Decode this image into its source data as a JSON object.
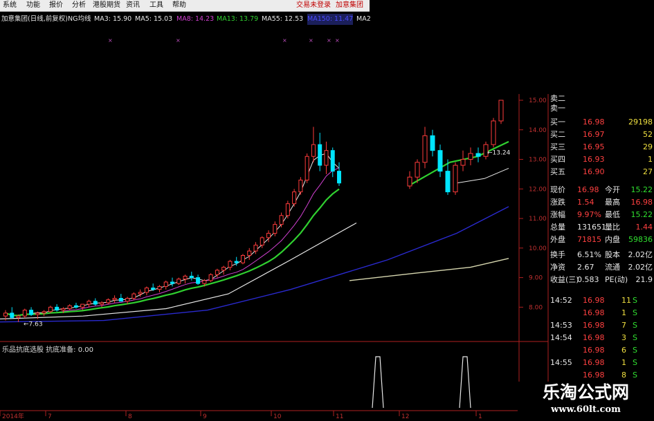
{
  "menu": {
    "items": [
      "系统",
      "功能",
      "报价",
      "分析",
      "港股期货",
      "资讯",
      "工具",
      "帮助"
    ],
    "login": "交易未登录",
    "stock_name": "加意集团"
  },
  "ma_bar": {
    "title": "加意集团(日线,前复权)",
    "indicator": "NG均线",
    "ma": [
      {
        "label": "MA3: 15.90",
        "color": "#e8e8e8"
      },
      {
        "label": "MA5: 15.03",
        "color": "#e8e8e8"
      },
      {
        "label": "MA8: 14.23",
        "color": "#d040d0"
      },
      {
        "label": "MA13: 13.79",
        "color": "#30d030"
      },
      {
        "label": "MA55: 12.53",
        "color": "#e8e8e8"
      },
      {
        "label": "MA150: 11.47",
        "color": "#3030ff"
      },
      {
        "label": "MA2",
        "color": "#e8e8e8"
      }
    ]
  },
  "price_axis": {
    "ticks": [
      "15.00",
      "14.00",
      "13.00",
      "12.00",
      "11.00",
      "10.00",
      "9.00",
      "8.00"
    ]
  },
  "chart_data": {
    "type": "candlestick",
    "x_ticks": [
      "2014年",
      "7",
      "8",
      "9",
      "10",
      "11",
      "12",
      "1"
    ],
    "y_range": [
      7.4,
      15.0
    ],
    "annotations": {
      "low": "7.63",
      "mid": "13.24"
    },
    "colors": {
      "up": "#ff3b3b",
      "down": "#00e5ff",
      "ma_fast": "#e8e8e8",
      "ma8": "#d040d0",
      "ma13": "#30d030",
      "ma55": "#e8e8e8",
      "ma150": "#2a2ad0",
      "ma_long": "#d8d8b0"
    },
    "candles": [
      [
        7.7,
        7.9,
        7.55,
        7.8
      ],
      [
        7.8,
        8.0,
        7.6,
        7.65
      ],
      [
        7.65,
        7.75,
        7.5,
        7.7
      ],
      [
        7.7,
        7.95,
        7.63,
        7.9
      ],
      [
        7.9,
        8.0,
        7.7,
        7.75
      ],
      [
        7.75,
        7.85,
        7.6,
        7.8
      ],
      [
        7.8,
        7.9,
        7.7,
        7.85
      ],
      [
        7.85,
        8.05,
        7.8,
        8.0
      ],
      [
        8.0,
        8.1,
        7.85,
        7.9
      ],
      [
        7.9,
        8.0,
        7.8,
        7.95
      ],
      [
        7.95,
        8.1,
        7.9,
        8.05
      ],
      [
        8.05,
        8.15,
        7.95,
        8.0
      ],
      [
        8.0,
        8.1,
        7.9,
        8.1
      ],
      [
        8.1,
        8.25,
        8.0,
        8.2
      ],
      [
        8.2,
        8.3,
        8.05,
        8.1
      ],
      [
        8.1,
        8.2,
        8.0,
        8.15
      ],
      [
        8.15,
        8.3,
        8.1,
        8.25
      ],
      [
        8.25,
        8.4,
        8.15,
        8.3
      ],
      [
        8.3,
        8.45,
        8.2,
        8.2
      ],
      [
        8.2,
        8.35,
        8.1,
        8.3
      ],
      [
        8.3,
        8.5,
        8.25,
        8.45
      ],
      [
        8.45,
        8.6,
        8.35,
        8.5
      ],
      [
        8.5,
        8.7,
        8.4,
        8.65
      ],
      [
        8.65,
        8.8,
        8.55,
        8.6
      ],
      [
        8.6,
        8.75,
        8.5,
        8.7
      ],
      [
        8.7,
        8.9,
        8.6,
        8.85
      ],
      [
        8.85,
        9.0,
        8.7,
        8.8
      ],
      [
        8.8,
        9.0,
        8.75,
        8.95
      ],
      [
        8.95,
        9.1,
        8.8,
        9.05
      ],
      [
        9.05,
        9.2,
        8.9,
        9.0
      ],
      [
        9.0,
        9.1,
        8.75,
        8.8
      ],
      [
        8.8,
        8.95,
        8.7,
        8.9
      ],
      [
        8.9,
        9.15,
        8.85,
        9.1
      ],
      [
        9.1,
        9.3,
        9.0,
        9.25
      ],
      [
        9.25,
        9.4,
        9.1,
        9.35
      ],
      [
        9.35,
        9.6,
        9.25,
        9.55
      ],
      [
        9.55,
        9.7,
        9.4,
        9.5
      ],
      [
        9.5,
        9.8,
        9.45,
        9.75
      ],
      [
        9.75,
        10.0,
        9.6,
        9.9
      ],
      [
        9.9,
        10.2,
        9.8,
        10.1
      ],
      [
        10.1,
        10.4,
        10.0,
        10.35
      ],
      [
        10.35,
        10.6,
        10.2,
        10.5
      ],
      [
        10.5,
        10.9,
        10.4,
        10.8
      ],
      [
        10.8,
        11.2,
        10.7,
        11.1
      ],
      [
        11.1,
        11.6,
        11.0,
        11.5
      ],
      [
        11.5,
        12.0,
        11.4,
        11.9
      ],
      [
        11.9,
        12.4,
        11.8,
        12.3
      ],
      [
        12.3,
        13.2,
        12.2,
        13.1
      ],
      [
        13.1,
        14.1,
        12.9,
        13.5
      ],
      [
        13.5,
        13.9,
        12.6,
        12.8
      ],
      [
        12.8,
        13.6,
        12.5,
        13.3
      ],
      [
        13.3,
        13.4,
        12.4,
        12.6
      ],
      [
        12.6,
        12.9,
        12.1,
        12.2
      ]
    ]
  },
  "quote": {
    "sell_header": [
      "卖二",
      "卖一"
    ],
    "bids": [
      {
        "label": "买一",
        "price": "16.98",
        "vol": "29198"
      },
      {
        "label": "买二",
        "price": "16.97",
        "vol": "52"
      },
      {
        "label": "买三",
        "price": "16.95",
        "vol": "29"
      },
      {
        "label": "买四",
        "price": "16.93",
        "vol": "1"
      },
      {
        "label": "买五",
        "price": "16.90",
        "vol": "27"
      }
    ],
    "stats": [
      {
        "l1": "现价",
        "v1": "16.98",
        "l2": "今开",
        "v2": "15.22",
        "c1": "#ff4040",
        "c2": "#30e030"
      },
      {
        "l1": "涨跌",
        "v1": "1.54",
        "l2": "最高",
        "v2": "16.98",
        "c1": "#ff4040",
        "c2": "#ff4040"
      },
      {
        "l1": "涨幅",
        "v1": "9.97%",
        "l2": "最低",
        "v2": "15.22",
        "c1": "#ff4040",
        "c2": "#30e030"
      },
      {
        "l1": "总量",
        "v1": "131651",
        "l2": "量比",
        "v2": "1.44",
        "c1": "#e8e8e8",
        "c2": "#ff4040"
      },
      {
        "l1": "外盘",
        "v1": "71815",
        "l2": "内盘",
        "v2": "59836",
        "c1": "#ff4040",
        "c2": "#30e030"
      },
      {
        "l1": "换手",
        "v1": "6.51%",
        "l2": "股本",
        "v2": "2.02亿",
        "c1": "#e8e8e8",
        "c2": "#e8e8e8"
      },
      {
        "l1": "净资",
        "v1": "2.67",
        "l2": "流通",
        "v2": "2.02亿",
        "c1": "#e8e8e8",
        "c2": "#e8e8e8"
      },
      {
        "l1": "收益(三)",
        "v1": "0.583",
        "l2": "PE(动)",
        "v2": "21.9",
        "c1": "#e8e8e8",
        "c2": "#e8e8e8"
      }
    ],
    "ticks": [
      {
        "time": "14:52",
        "price": "16.98",
        "vol": "11",
        "side": "S"
      },
      {
        "time": "",
        "price": "16.98",
        "vol": "1",
        "side": "S"
      },
      {
        "time": "14:53",
        "price": "16.98",
        "vol": "7",
        "side": "S"
      },
      {
        "time": "14:54",
        "price": "16.98",
        "vol": "3",
        "side": "S"
      },
      {
        "time": "",
        "price": "16.98",
        "vol": "6",
        "side": "S"
      },
      {
        "time": "14:55",
        "price": "16.98",
        "vol": "1",
        "side": "S"
      },
      {
        "time": "",
        "price": "16.98",
        "vol": "8",
        "side": "S"
      }
    ]
  },
  "lower_panel": {
    "title": "乐品抗底选股 抗底准备: 0.00"
  },
  "watermark": {
    "line1": "乐淘公式网",
    "line2": "www.60lt.com"
  }
}
